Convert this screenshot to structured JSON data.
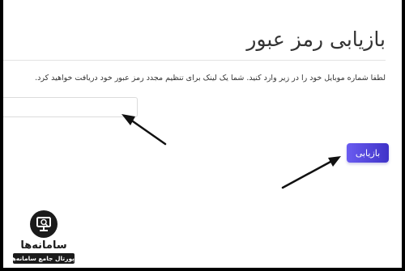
{
  "page": {
    "title": "بازیابی رمز عبور",
    "instruction": "لطفا شماره موبایل خود را در زیر وارد کنید. شما یک لینک برای تنظیم مجدد رمز عبور خود دریافت خواهید کرد."
  },
  "form": {
    "phone_value": "",
    "phone_placeholder": "",
    "submit_label": "بازیابی"
  },
  "logo": {
    "name": "سامانه‌ها",
    "tagline": "پورتال جامع سامانه‌ها"
  },
  "colors": {
    "accent": "#5546e0",
    "annotation_arrow": "#111111"
  }
}
